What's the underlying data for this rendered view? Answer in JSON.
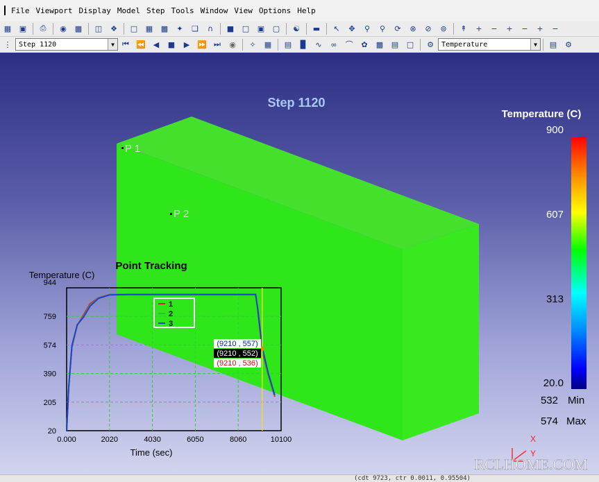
{
  "menu": [
    "File",
    "Viewport",
    "Display",
    "Model",
    "Step",
    "Tools",
    "Window",
    "View",
    "Options",
    "Help"
  ],
  "toolbar": {
    "step_select": "Step 1120",
    "variable_select": "Temperature"
  },
  "viewport": {
    "step_title": "Step 1120",
    "point_labels": [
      "P 1",
      "P 2"
    ]
  },
  "legend": {
    "title": "Temperature (C)",
    "ticks": [
      "900",
      "607",
      "313",
      "20.0"
    ],
    "min_value": "532",
    "min_label": "Min",
    "max_value": "574",
    "max_label": "Max",
    "colors": [
      "#ff0000",
      "#ff8000",
      "#ffff00",
      "#00ff00",
      "#00ffff",
      "#0080ff",
      "#0000ff",
      "#000080"
    ]
  },
  "axis_triad": {
    "x": "X",
    "y": "Y"
  },
  "watermark": "RCLHOME.COM",
  "status_text": "(cdt 9723, ctr 0.0011, 0.95504)",
  "chart_data": {
    "type": "line",
    "title": "Point Tracking",
    "ylabel": "Temperature (C)",
    "xlabel": "Time (sec)",
    "xlim": [
      0,
      10100
    ],
    "ylim": [
      20,
      944
    ],
    "x_ticks": [
      "0.000",
      "2020",
      "4030",
      "6050",
      "8060",
      "10100"
    ],
    "y_ticks": [
      "944",
      "759",
      "574",
      "390",
      "205",
      "20"
    ],
    "marker_x": 9210,
    "series": [
      {
        "name": "1",
        "color": "#e02020",
        "x": [
          0,
          100,
          250,
          500,
          800,
          1100,
          1500,
          2020,
          3000,
          5000,
          7000,
          8500,
          8900,
          9000,
          9210,
          9500,
          9800
        ],
        "y": [
          20,
          300,
          560,
          700,
          770,
          840,
          880,
          900,
          902,
          902,
          902,
          902,
          902,
          800,
          536,
          380,
          240
        ]
      },
      {
        "name": "2",
        "color": "#30c030",
        "x": [
          0,
          100,
          250,
          500,
          800,
          1100,
          1500,
          2020,
          3000,
          5000,
          7000,
          8500,
          8900,
          9000,
          9210,
          9500,
          9800
        ],
        "y": [
          20,
          305,
          565,
          702,
          760,
          830,
          878,
          899,
          901,
          901,
          901,
          901,
          901,
          805,
          552,
          385,
          245
        ]
      },
      {
        "name": "3",
        "color": "#2040d0",
        "x": [
          0,
          100,
          250,
          500,
          800,
          1100,
          1500,
          2020,
          3000,
          5000,
          7000,
          8500,
          8900,
          9000,
          9210,
          9500,
          9800
        ],
        "y": [
          20,
          310,
          570,
          705,
          755,
          825,
          876,
          898,
          900,
          900,
          900,
          900,
          900,
          810,
          557,
          390,
          250
        ]
      }
    ],
    "tooltips": [
      "(9210 , 557)",
      "(9210 , 552)",
      "(9210 , 536)"
    ],
    "legend_entries": [
      "1",
      "2",
      "3"
    ]
  }
}
